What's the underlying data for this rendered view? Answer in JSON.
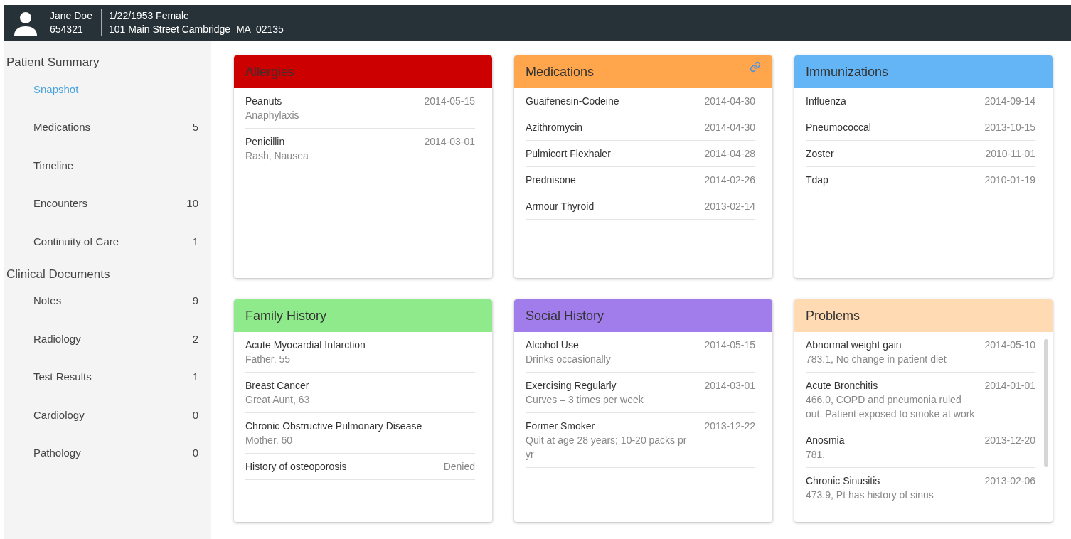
{
  "header": {
    "name": "Jane Doe",
    "mrn": "654321",
    "dob_gender": "1/22/1953 Female",
    "address": "101 Main Street Cambridge  MA  02135"
  },
  "sidebar": [
    {
      "title": "Patient Summary",
      "items": [
        {
          "label": "Snapshot",
          "selected": true
        },
        {
          "label": "Medications",
          "count": "5",
          "selected": false
        },
        {
          "label": "Timeline",
          "selected": false
        },
        {
          "label": "Encounters",
          "count": "10",
          "selected": false
        },
        {
          "label": "Continuity of Care",
          "count": "1",
          "selected": false
        }
      ]
    },
    {
      "title": "Clinical Documents",
      "items": [
        {
          "label": "Notes",
          "count": "9",
          "selected": false
        },
        {
          "label": "Radiology",
          "count": "2",
          "selected": false
        },
        {
          "label": "Test Results",
          "count": "1",
          "selected": false
        },
        {
          "label": "Cardiology",
          "count": "0",
          "selected": false
        },
        {
          "label": "Pathology",
          "count": "0",
          "selected": false
        }
      ]
    }
  ],
  "cards": [
    {
      "title": "Allergies",
      "color": "#cc0000",
      "linked": false,
      "scrollable": false,
      "items": [
        {
          "name": "Peanuts",
          "value": "2014-05-15",
          "detail": "Anaphylaxis"
        },
        {
          "name": "Penicillin",
          "value": "2014-03-01",
          "detail": "Rash, Nausea"
        }
      ]
    },
    {
      "title": "Medications",
      "color": "#ffa64d",
      "linked": true,
      "scrollable": false,
      "items": [
        {
          "name": "Guaifenesin-Codeine",
          "value": "2014-04-30"
        },
        {
          "name": "Azithromycin",
          "value": "2014-04-30"
        },
        {
          "name": "Pulmicort Flexhaler",
          "value": "2014-04-28"
        },
        {
          "name": "Prednisone",
          "value": "2014-02-26"
        },
        {
          "name": "Armour Thyroid",
          "value": "2013-02-14"
        }
      ]
    },
    {
      "title": "Immunizations",
      "color": "#64b5f6",
      "linked": false,
      "scrollable": false,
      "items": [
        {
          "name": "Influenza",
          "value": "2014-09-14"
        },
        {
          "name": "Pneumococcal",
          "value": "2013-10-15"
        },
        {
          "name": "Zoster",
          "value": "2010-11-01"
        },
        {
          "name": "Tdap",
          "value": "2010-01-19"
        }
      ]
    },
    {
      "title": "Family History",
      "color": "#8fea8b",
      "linked": false,
      "scrollable": false,
      "items": [
        {
          "name": "Acute Myocardial Infarction",
          "detail": "Father, 55"
        },
        {
          "name": "Breast Cancer",
          "detail": "Great Aunt, 63"
        },
        {
          "name": "Chronic Obstructive Pulmonary Disease",
          "detail": "Mother, 60"
        },
        {
          "name": "History of osteoporosis",
          "value": "Denied"
        }
      ]
    },
    {
      "title": "Social History",
      "color": "#a07deb",
      "linked": false,
      "scrollable": false,
      "items": [
        {
          "name": "Alcohol Use",
          "value": "2014-05-15",
          "detail": "Drinks occasionally"
        },
        {
          "name": "Exercising Regularly",
          "value": "2014-03-01",
          "detail": "Curves – 3 times per week"
        },
        {
          "name": "Former Smoker",
          "value": "2013-12-22",
          "detail": "Quit at age 28 years; 10-20 packs pr yr"
        }
      ]
    },
    {
      "title": "Problems",
      "color": "#ffdab3",
      "linked": false,
      "scrollable": true,
      "items": [
        {
          "name": "Abnormal weight gain",
          "value": "2014-05-10",
          "detail": "783.1, No change in patient diet"
        },
        {
          "name": "Acute Bronchitis",
          "value": "2014-01-01",
          "detail": "466.0, COPD and pneumonia ruled out. Patient exposed to smoke at work"
        },
        {
          "name": "Anosmia",
          "value": "2013-12-20",
          "detail": "781."
        },
        {
          "name": "Chronic Sinusitis",
          "value": "2013-02-06",
          "detail": "473.9, Pt has history of sinus"
        }
      ]
    }
  ]
}
